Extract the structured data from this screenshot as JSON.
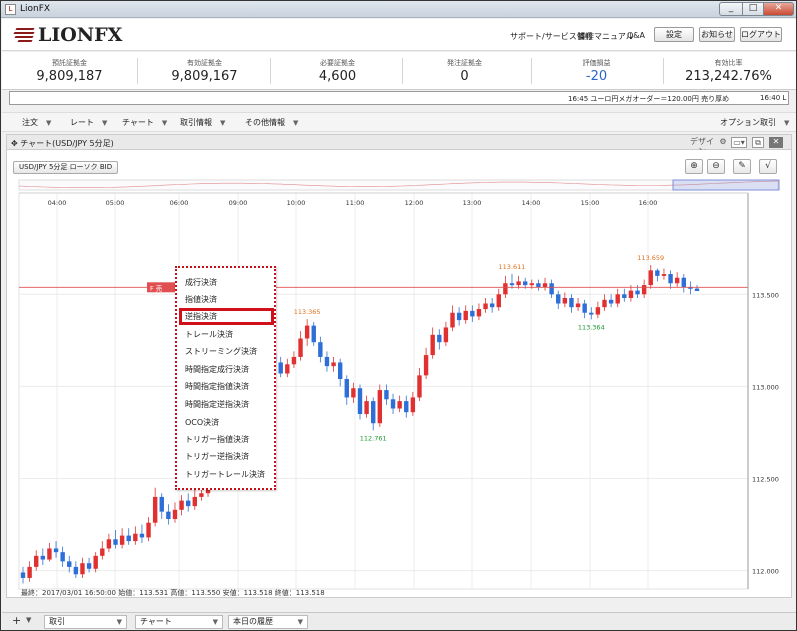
{
  "window": {
    "title": "LionFX",
    "min": "_",
    "max": "□",
    "close": "✕"
  },
  "header": {
    "logo_text": "LIONFX",
    "links": [
      "サポート/サービス情報",
      "操作マニュアル",
      "Q&A"
    ],
    "buttons": [
      "設定",
      "お知らせ",
      "ログアウト"
    ]
  },
  "summary": [
    {
      "label": "預託証拠金",
      "value": "9,809,187"
    },
    {
      "label": "有効証拠金",
      "value": "9,809,167"
    },
    {
      "label": "必要証拠金",
      "value": "4,600"
    },
    {
      "label": "発注証拠金",
      "value": "0"
    },
    {
      "label": "評価損益",
      "value": "-20"
    },
    {
      "label": "有効比率",
      "value": "213,242.76%"
    }
  ],
  "colors": {
    "negative": "#2a66c9",
    "bull": "#e03030",
    "bear": "#2d6fd6",
    "accent": "#c8101a"
  },
  "ticker": {
    "text": "16:45  ユーロ円メガオーダー＝120.00円  売り厚め",
    "text2": "16:40  L"
  },
  "menubar": {
    "items": [
      "注文",
      "レート",
      "チャート",
      "取引情報",
      "その他情報"
    ],
    "right": "オプション取引"
  },
  "panel": {
    "title": "チャート(USD/JPY 5分足)",
    "design": "デザイン",
    "symbol_button": "USD/JPY 5分足 ローソク BID"
  },
  "context_menu": {
    "position_tag": "F 売",
    "items": [
      "成行決済",
      "指値決済",
      "逆指決済",
      "トレール決済",
      "ストリーミング決済",
      "時間指定成行決済",
      "時間指定指値決済",
      "時間指定逆指決済",
      "OCO決済",
      "トリガー指値決済",
      "トリガー逆指決済",
      "トリガートレール決済"
    ],
    "highlighted": "逆指決済"
  },
  "chart_data": {
    "type": "candlestick",
    "times": [
      "04:00",
      "05:00",
      "06:00",
      "09:00",
      "10:00",
      "11:00",
      "12:00",
      "13:00",
      "14:00",
      "15:00",
      "16:00"
    ],
    "y_ticks": [
      "113.500",
      "113.000",
      "112.500",
      "112.000"
    ],
    "ylim": [
      111.9,
      114.05
    ],
    "position_line": 113.538,
    "annotations": [
      {
        "text": "113.365",
        "value": 113.365,
        "type": "high"
      },
      {
        "text": "112.761",
        "value": 112.761,
        "type": "low"
      },
      {
        "text": "113.611",
        "value": 113.611,
        "type": "high"
      },
      {
        "text": "113.364",
        "value": 113.364,
        "type": "low"
      },
      {
        "text": "113.659",
        "value": 113.659,
        "type": "high"
      }
    ],
    "status": "最終：2017/03/01 16:50:00  始値：113.531  高値：113.550  安値：113.518  終値：113.518",
    "series": [
      {
        "x": 0.0,
        "o": 111.99,
        "c": 111.96,
        "h": 112.02,
        "l": 111.93
      },
      {
        "x": 1.0,
        "o": 111.96,
        "c": 112.02,
        "h": 112.05,
        "l": 111.94
      },
      {
        "x": 2.0,
        "o": 112.02,
        "c": 112.08,
        "h": 112.11,
        "l": 112.0
      },
      {
        "x": 3.0,
        "o": 112.08,
        "c": 112.06,
        "h": 112.12,
        "l": 112.03
      },
      {
        "x": 4.0,
        "o": 112.06,
        "c": 112.12,
        "h": 112.15,
        "l": 112.05
      },
      {
        "x": 5.0,
        "o": 112.12,
        "c": 112.1,
        "h": 112.16,
        "l": 112.07
      },
      {
        "x": 6.0,
        "o": 112.1,
        "c": 112.05,
        "h": 112.13,
        "l": 112.02
      },
      {
        "x": 7.0,
        "o": 112.05,
        "c": 112.02,
        "h": 112.08,
        "l": 111.99
      },
      {
        "x": 8.0,
        "o": 112.02,
        "c": 111.98,
        "h": 112.05,
        "l": 111.96
      },
      {
        "x": 9.0,
        "o": 111.98,
        "c": 112.04,
        "h": 112.07,
        "l": 111.96
      },
      {
        "x": 10.0,
        "o": 112.04,
        "c": 112.01,
        "h": 112.07,
        "l": 111.99
      },
      {
        "x": 11.0,
        "o": 112.01,
        "c": 112.08,
        "h": 112.1,
        "l": 111.99
      },
      {
        "x": 12.0,
        "o": 112.08,
        "c": 112.12,
        "h": 112.16,
        "l": 112.06
      },
      {
        "x": 13.0,
        "o": 112.12,
        "c": 112.17,
        "h": 112.2,
        "l": 112.1
      },
      {
        "x": 14.0,
        "o": 112.17,
        "c": 112.14,
        "h": 112.22,
        "l": 112.12
      },
      {
        "x": 15.0,
        "o": 112.14,
        "c": 112.19,
        "h": 112.23,
        "l": 112.12
      },
      {
        "x": 16.0,
        "o": 112.19,
        "c": 112.16,
        "h": 112.23,
        "l": 112.14
      },
      {
        "x": 17.0,
        "o": 112.16,
        "c": 112.2,
        "h": 112.24,
        "l": 112.14
      },
      {
        "x": 18.0,
        "o": 112.2,
        "c": 112.18,
        "h": 112.25,
        "l": 112.15
      },
      {
        "x": 19.0,
        "o": 112.18,
        "c": 112.26,
        "h": 112.29,
        "l": 112.16
      },
      {
        "x": 20.0,
        "o": 112.26,
        "c": 112.4,
        "h": 112.45,
        "l": 112.24
      },
      {
        "x": 21.0,
        "o": 112.4,
        "c": 112.32,
        "h": 112.42,
        "l": 112.28
      },
      {
        "x": 22.0,
        "o": 112.32,
        "c": 112.28,
        "h": 112.36,
        "l": 112.25
      },
      {
        "x": 23.0,
        "o": 112.28,
        "c": 112.33,
        "h": 112.37,
        "l": 112.26
      },
      {
        "x": 24.0,
        "o": 112.33,
        "c": 112.38,
        "h": 112.41,
        "l": 112.3
      },
      {
        "x": 25.0,
        "o": 112.38,
        "c": 112.35,
        "h": 112.42,
        "l": 112.32
      },
      {
        "x": 26.0,
        "o": 112.35,
        "c": 112.4,
        "h": 112.44,
        "l": 112.33
      },
      {
        "x": 27.0,
        "o": 112.4,
        "c": 112.42,
        "h": 112.46,
        "l": 112.38
      },
      {
        "x": 28.0,
        "o": 112.42,
        "c": 112.48,
        "h": 112.52,
        "l": 112.4
      },
      {
        "x": 29.0,
        "o": 112.48,
        "c": 112.58,
        "h": 112.63,
        "l": 112.46
      },
      {
        "x": 30.0,
        "o": 112.58,
        "c": 112.66,
        "h": 112.7,
        "l": 112.55
      },
      {
        "x": 31.0,
        "o": 112.66,
        "c": 112.73,
        "h": 112.77,
        "l": 112.63
      },
      {
        "x": 32.0,
        "o": 112.73,
        "c": 112.82,
        "h": 112.86,
        "l": 112.7
      },
      {
        "x": 33.0,
        "o": 112.82,
        "c": 112.95,
        "h": 113.0,
        "l": 112.8
      },
      {
        "x": 34.0,
        "o": 112.95,
        "c": 113.03,
        "h": 113.08,
        "l": 112.92
      },
      {
        "x": 35.0,
        "o": 113.03,
        "c": 113.1,
        "h": 113.14,
        "l": 113.0
      },
      {
        "x": 36.0,
        "o": 113.1,
        "c": 113.14,
        "h": 113.18,
        "l": 113.07
      },
      {
        "x": 37.0,
        "o": 113.14,
        "c": 113.18,
        "h": 113.22,
        "l": 113.12
      },
      {
        "x": 38.0,
        "o": 113.18,
        "c": 113.13,
        "h": 113.22,
        "l": 113.1
      },
      {
        "x": 39.0,
        "o": 113.13,
        "c": 113.07,
        "h": 113.16,
        "l": 113.05
      },
      {
        "x": 40.0,
        "o": 113.07,
        "c": 113.12,
        "h": 113.15,
        "l": 113.05
      },
      {
        "x": 41.0,
        "o": 113.12,
        "c": 113.16,
        "h": 113.19,
        "l": 113.1
      },
      {
        "x": 42.0,
        "o": 113.16,
        "c": 113.26,
        "h": 113.3,
        "l": 113.14
      },
      {
        "x": 43.0,
        "o": 113.26,
        "c": 113.33,
        "h": 113.365,
        "l": 113.22
      },
      {
        "x": 44.0,
        "o": 113.33,
        "c": 113.24,
        "h": 113.35,
        "l": 113.22
      },
      {
        "x": 45.0,
        "o": 113.24,
        "c": 113.16,
        "h": 113.27,
        "l": 113.13
      },
      {
        "x": 46.0,
        "o": 113.16,
        "c": 113.11,
        "h": 113.19,
        "l": 113.08
      },
      {
        "x": 47.0,
        "o": 113.11,
        "c": 113.13,
        "h": 113.16,
        "l": 113.08
      },
      {
        "x": 48.0,
        "o": 113.13,
        "c": 113.04,
        "h": 113.15,
        "l": 113.0
      },
      {
        "x": 49.0,
        "o": 113.04,
        "c": 112.94,
        "h": 113.06,
        "l": 112.9
      },
      {
        "x": 50.0,
        "o": 112.94,
        "c": 112.99,
        "h": 113.02,
        "l": 112.91
      },
      {
        "x": 51.0,
        "o": 112.99,
        "c": 112.85,
        "h": 113.01,
        "l": 112.82
      },
      {
        "x": 52.0,
        "o": 112.85,
        "c": 112.92,
        "h": 112.95,
        "l": 112.83
      },
      {
        "x": 53.0,
        "o": 112.92,
        "c": 112.8,
        "h": 112.94,
        "l": 112.761
      },
      {
        "x": 54.0,
        "o": 112.8,
        "c": 112.98,
        "h": 113.01,
        "l": 112.78
      },
      {
        "x": 55.0,
        "o": 112.98,
        "c": 112.93,
        "h": 113.01,
        "l": 112.9
      },
      {
        "x": 56.0,
        "o": 112.93,
        "c": 112.88,
        "h": 112.96,
        "l": 112.85
      },
      {
        "x": 57.0,
        "o": 112.88,
        "c": 112.92,
        "h": 112.95,
        "l": 112.86
      },
      {
        "x": 58.0,
        "o": 112.92,
        "c": 112.86,
        "h": 112.95,
        "l": 112.83
      },
      {
        "x": 59.0,
        "o": 112.86,
        "c": 112.94,
        "h": 112.97,
        "l": 112.84
      },
      {
        "x": 60.0,
        "o": 112.94,
        "c": 113.06,
        "h": 113.1,
        "l": 112.92
      },
      {
        "x": 61.0,
        "o": 113.06,
        "c": 113.17,
        "h": 113.21,
        "l": 113.04
      },
      {
        "x": 62.0,
        "o": 113.17,
        "c": 113.28,
        "h": 113.32,
        "l": 113.15
      },
      {
        "x": 63.0,
        "o": 113.28,
        "c": 113.24,
        "h": 113.31,
        "l": 113.2
      },
      {
        "x": 64.0,
        "o": 113.24,
        "c": 113.32,
        "h": 113.35,
        "l": 113.22
      },
      {
        "x": 65.0,
        "o": 113.32,
        "c": 113.4,
        "h": 113.44,
        "l": 113.3
      },
      {
        "x": 66.0,
        "o": 113.4,
        "c": 113.36,
        "h": 113.43,
        "l": 113.33
      },
      {
        "x": 67.0,
        "o": 113.36,
        "c": 113.41,
        "h": 113.44,
        "l": 113.34
      },
      {
        "x": 68.0,
        "o": 113.41,
        "c": 113.38,
        "h": 113.44,
        "l": 113.35
      },
      {
        "x": 69.0,
        "o": 113.38,
        "c": 113.42,
        "h": 113.45,
        "l": 113.36
      },
      {
        "x": 70.0,
        "o": 113.42,
        "c": 113.45,
        "h": 113.48,
        "l": 113.4
      },
      {
        "x": 71.0,
        "o": 113.45,
        "c": 113.43,
        "h": 113.48,
        "l": 113.4
      },
      {
        "x": 72.0,
        "o": 113.43,
        "c": 113.5,
        "h": 113.53,
        "l": 113.41
      },
      {
        "x": 73.0,
        "o": 113.5,
        "c": 113.56,
        "h": 113.6,
        "l": 113.48
      },
      {
        "x": 74.0,
        "o": 113.56,
        "c": 113.55,
        "h": 113.611,
        "l": 113.53
      },
      {
        "x": 75.0,
        "o": 113.55,
        "c": 113.57,
        "h": 113.6,
        "l": 113.53
      },
      {
        "x": 76.0,
        "o": 113.57,
        "c": 113.55,
        "h": 113.59,
        "l": 113.53
      },
      {
        "x": 77.0,
        "o": 113.55,
        "c": 113.56,
        "h": 113.58,
        "l": 113.53
      },
      {
        "x": 78.0,
        "o": 113.56,
        "c": 113.54,
        "h": 113.58,
        "l": 113.52
      },
      {
        "x": 79.0,
        "o": 113.54,
        "c": 113.56,
        "h": 113.59,
        "l": 113.52
      },
      {
        "x": 80.0,
        "o": 113.56,
        "c": 113.5,
        "h": 113.58,
        "l": 113.48
      },
      {
        "x": 81.0,
        "o": 113.5,
        "c": 113.45,
        "h": 113.52,
        "l": 113.42
      },
      {
        "x": 82.0,
        "o": 113.45,
        "c": 113.48,
        "h": 113.51,
        "l": 113.43
      },
      {
        "x": 83.0,
        "o": 113.48,
        "c": 113.43,
        "h": 113.5,
        "l": 113.4
      },
      {
        "x": 84.0,
        "o": 113.43,
        "c": 113.45,
        "h": 113.48,
        "l": 113.41
      },
      {
        "x": 85.0,
        "o": 113.45,
        "c": 113.4,
        "h": 113.47,
        "l": 113.37
      },
      {
        "x": 86.0,
        "o": 113.4,
        "c": 113.39,
        "h": 113.43,
        "l": 113.364
      },
      {
        "x": 87.0,
        "o": 113.39,
        "c": 113.43,
        "h": 113.46,
        "l": 113.37
      },
      {
        "x": 88.0,
        "o": 113.43,
        "c": 113.47,
        "h": 113.5,
        "l": 113.41
      },
      {
        "x": 89.0,
        "o": 113.47,
        "c": 113.45,
        "h": 113.5,
        "l": 113.43
      },
      {
        "x": 90.0,
        "o": 113.45,
        "c": 113.5,
        "h": 113.53,
        "l": 113.43
      },
      {
        "x": 91.0,
        "o": 113.5,
        "c": 113.48,
        "h": 113.53,
        "l": 113.46
      },
      {
        "x": 92.0,
        "o": 113.48,
        "c": 113.52,
        "h": 113.55,
        "l": 113.46
      },
      {
        "x": 93.0,
        "o": 113.52,
        "c": 113.5,
        "h": 113.55,
        "l": 113.48
      },
      {
        "x": 94.0,
        "o": 113.5,
        "c": 113.55,
        "h": 113.58,
        "l": 113.48
      },
      {
        "x": 95.0,
        "o": 113.55,
        "c": 113.63,
        "h": 113.659,
        "l": 113.53
      },
      {
        "x": 96.0,
        "o": 113.63,
        "c": 113.6,
        "h": 113.64,
        "l": 113.57
      },
      {
        "x": 97.0,
        "o": 113.6,
        "c": 113.61,
        "h": 113.64,
        "l": 113.58
      },
      {
        "x": 98.0,
        "o": 113.61,
        "c": 113.56,
        "h": 113.63,
        "l": 113.53
      },
      {
        "x": 99.0,
        "o": 113.56,
        "c": 113.59,
        "h": 113.62,
        "l": 113.54
      },
      {
        "x": 100.0,
        "o": 113.59,
        "c": 113.54,
        "h": 113.61,
        "l": 113.51
      },
      {
        "x": 101.0,
        "o": 113.54,
        "c": 113.53,
        "h": 113.57,
        "l": 113.5
      },
      {
        "x": 102.0,
        "o": 113.531,
        "c": 113.518,
        "h": 113.55,
        "l": 113.518
      }
    ]
  },
  "bottom_tabs": [
    "取引",
    "チャート",
    "本日の履歴"
  ]
}
